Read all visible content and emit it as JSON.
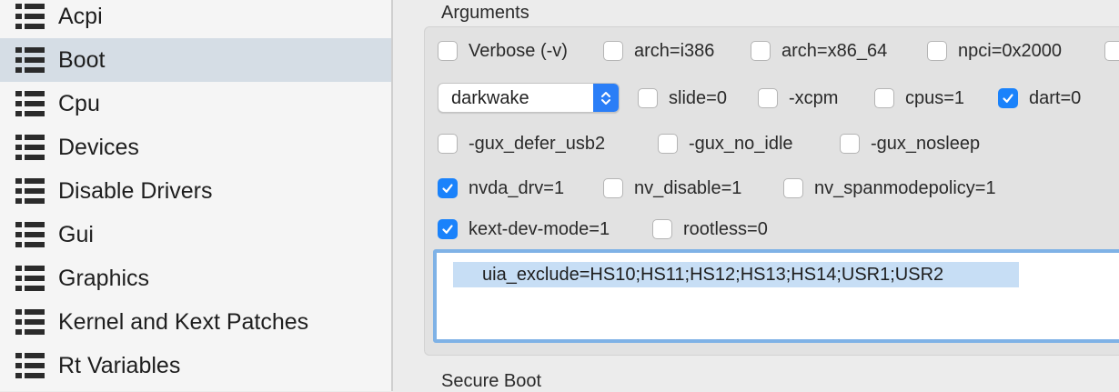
{
  "sidebar": {
    "items": [
      {
        "label": "Acpi",
        "selected": false
      },
      {
        "label": "Boot",
        "selected": true
      },
      {
        "label": "Cpu",
        "selected": false
      },
      {
        "label": "Devices",
        "selected": false
      },
      {
        "label": "Disable Drivers",
        "selected": false
      },
      {
        "label": "Gui",
        "selected": false
      },
      {
        "label": "Graphics",
        "selected": false
      },
      {
        "label": "Kernel and Kext Patches",
        "selected": false
      },
      {
        "label": "Rt Variables",
        "selected": false
      }
    ],
    "item_icon": "list-icon",
    "selected_color": "#d5dde5"
  },
  "arguments": {
    "title": "Arguments",
    "checkboxes": [
      {
        "label": "Verbose (-v)",
        "checked": false
      },
      {
        "label": "arch=i386",
        "checked": false
      },
      {
        "label": "arch=x86_64",
        "checked": false
      },
      {
        "label": "npci=0x2000",
        "checked": false
      },
      {
        "label": "",
        "checked": false
      },
      {
        "label": "slide=0",
        "checked": false
      },
      {
        "label": "-xcpm",
        "checked": false
      },
      {
        "label": "cpus=1",
        "checked": false
      },
      {
        "label": "dart=0",
        "checked": true
      },
      {
        "label": "-gux_defer_usb2",
        "checked": false
      },
      {
        "label": "-gux_no_idle",
        "checked": false
      },
      {
        "label": "-gux_nosleep",
        "checked": false
      },
      {
        "label": "nvda_drv=1",
        "checked": true
      },
      {
        "label": "nv_disable=1",
        "checked": false
      },
      {
        "label": "nv_spanmodepolicy=1",
        "checked": false
      },
      {
        "label": "kext-dev-mode=1",
        "checked": true
      },
      {
        "label": "rootless=0",
        "checked": false
      }
    ],
    "dropdown": {
      "value": "darkwake",
      "icon": "updown-chevron-icon"
    },
    "boot_args_text": "uia_exclude=HS10;HS11;HS12;HS13;HS14;USR1;USR2"
  },
  "secure_boot": {
    "title": "Secure Boot"
  },
  "colors": {
    "accent": "#1a82fb",
    "focus_ring": "#7fb2e6",
    "text_selection": "#c7def5"
  }
}
